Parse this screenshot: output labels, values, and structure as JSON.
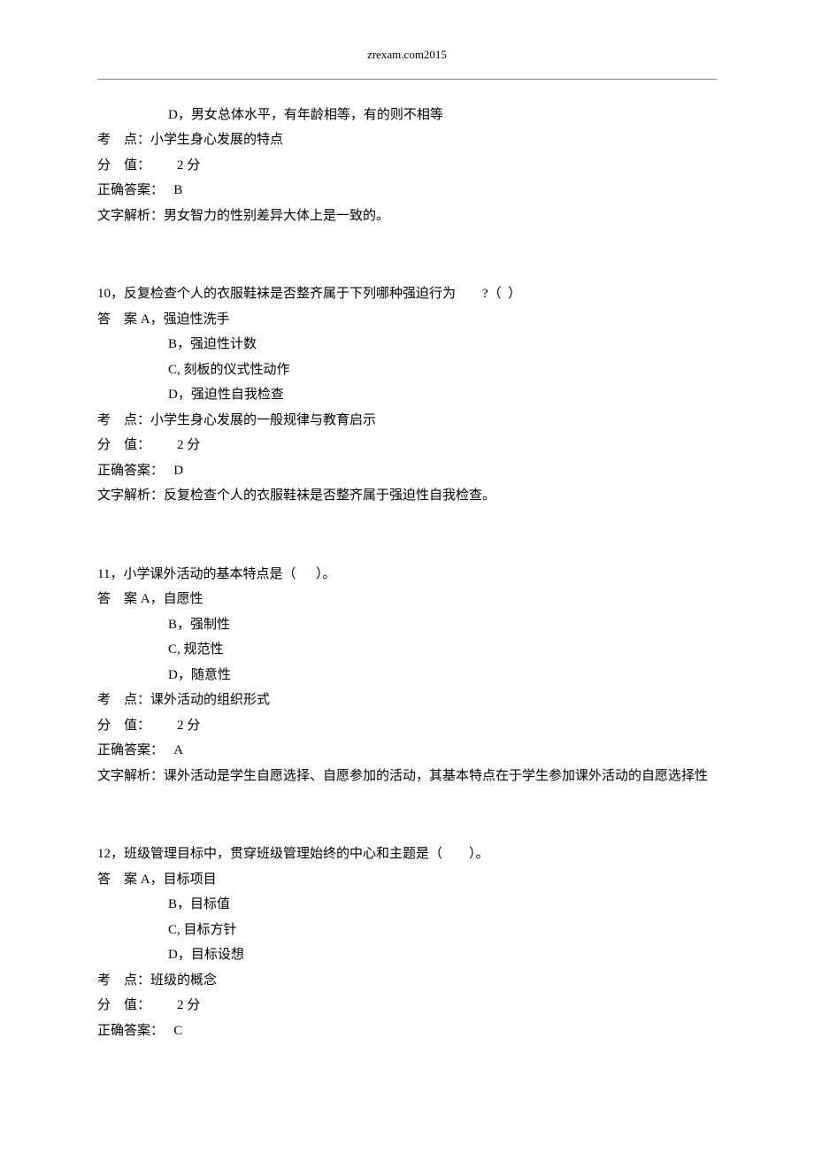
{
  "header": "zrexam.com2015",
  "q9_tail": {
    "option_d_label": "D，",
    "option_d_text": "男女总体水平，有年龄相等，有的则不相等",
    "topic_label": "考    点：",
    "topic_text": "小学生身心发展的特点",
    "score_label": "分    值：",
    "score_text": "        2 分",
    "answer_label": "正确答案：   ",
    "answer_text": "B",
    "explain_label": "文字解析：",
    "explain_text": "男女智力的性别差异大体上是一致的。"
  },
  "q10": {
    "number_label": "10，",
    "stem": "反复检查个人的衣服鞋袜是否整齐属于下列哪种强迫行为        ?（  ）",
    "answer_line_label": "答    案 ",
    "option_a_label": "A，",
    "option_a_text": "强迫性洗手",
    "option_b_label": "B，",
    "option_b_text": "强迫性计数",
    "option_c_label": "C, ",
    "option_c_text": "刻板的仪式性动作",
    "option_d_label": "D，",
    "option_d_text": "强迫性自我检查",
    "topic_label": "考    点：",
    "topic_text": "小学生身心发展的一般规律与教育启示",
    "score_label": "分    值：",
    "score_text": "        2 分",
    "answer_label": "正确答案：   ",
    "answer_text": "D",
    "explain_label": "文字解析：",
    "explain_text": "反复检查个人的衣服鞋袜是否整齐属于强迫性自我检查。"
  },
  "q11": {
    "number_label": "11，",
    "stem": "小学课外活动的基本特点是（      ）。",
    "answer_line_label": "答    案 ",
    "option_a_label": "A，",
    "option_a_text": "自愿性",
    "option_b_label": "B，",
    "option_b_text": "强制性",
    "option_c_label": "C, ",
    "option_c_text": "规范性",
    "option_d_label": "D，",
    "option_d_text": "随意性",
    "topic_label": "考    点：",
    "topic_text": "课外活动的组织形式",
    "score_label": "分    值：",
    "score_text": "        2 分",
    "answer_label": "正确答案：   ",
    "answer_text": "A",
    "explain_label": "文字解析：",
    "explain_text": "课外活动是学生自愿选择、自愿参加的活动，其基本特点在于学生参加课外活动的自愿选择性"
  },
  "q12": {
    "number_label": "12，",
    "stem": "班级管理目标中，贯穿班级管理始终的中心和主题是（        ）。",
    "answer_line_label": "答    案 ",
    "option_a_label": "A，",
    "option_a_text": "目标项目",
    "option_b_label": "B，",
    "option_b_text": "目标值",
    "option_c_label": "C, ",
    "option_c_text": "目标方针",
    "option_d_label": "D，",
    "option_d_text": "目标设想",
    "topic_label": "考    点：",
    "topic_text": "班级的概念",
    "score_label": "分    值：",
    "score_text": "        2 分",
    "answer_label": "正确答案：   ",
    "answer_text": "C"
  }
}
